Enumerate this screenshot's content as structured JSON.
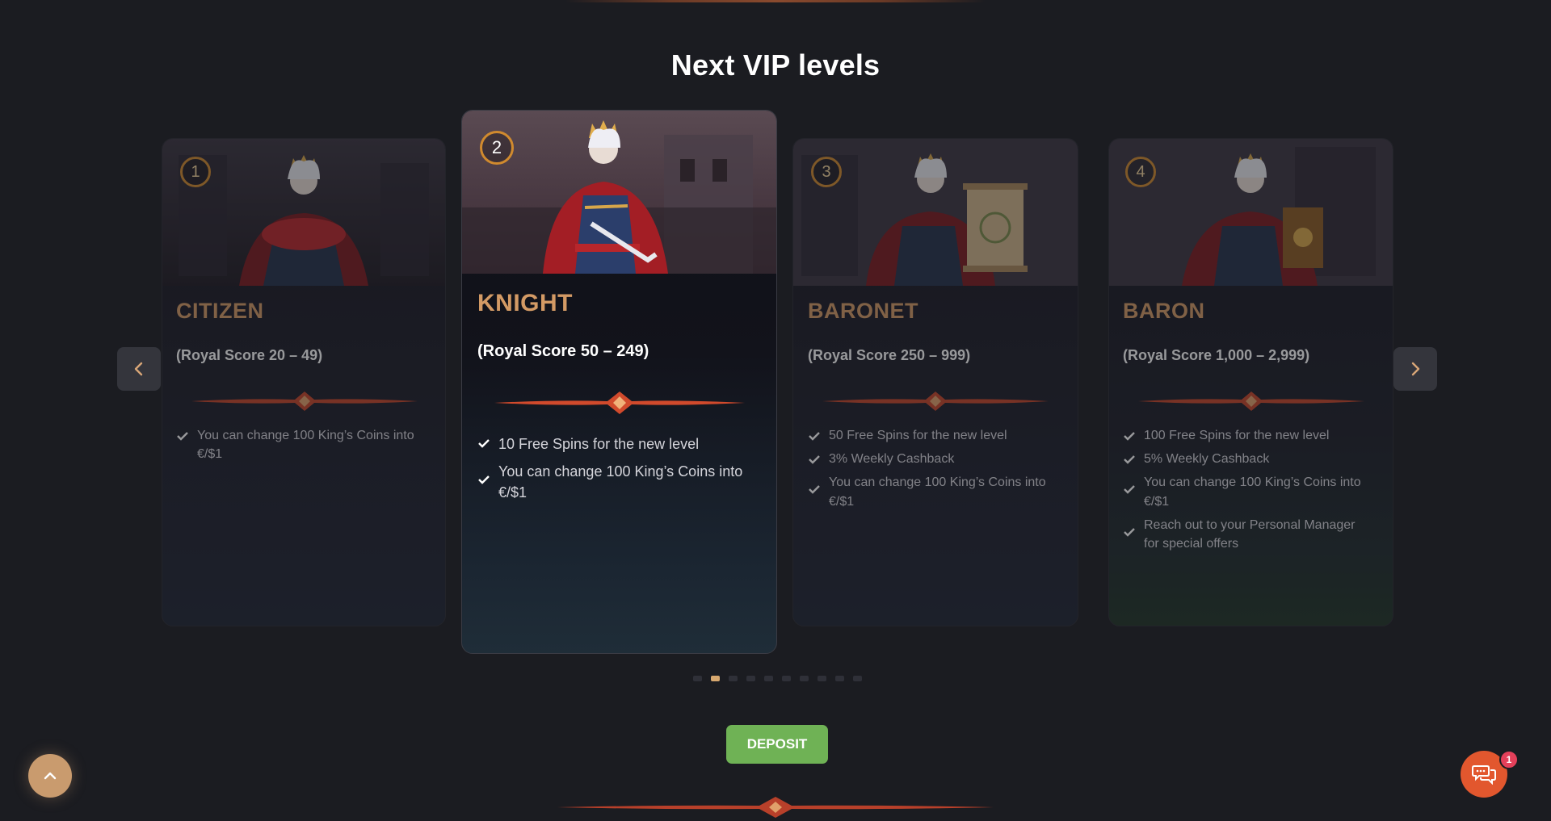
{
  "section": {
    "title": "Next VIP levels"
  },
  "carousel": {
    "cards": [
      {
        "level": "1",
        "name": "CITIZEN",
        "score": "(Royal Score 20 – 49)",
        "perks": [
          "You can change 100 King’s Coins into €/$1"
        ]
      },
      {
        "level": "2",
        "name": "KNIGHT",
        "score": "(Royal Score 50 – 249)",
        "perks": [
          "10 Free Spins for the new level",
          "You can change 100 King’s Coins into €/$1"
        ]
      },
      {
        "level": "3",
        "name": "BARONET",
        "score": "(Royal Score 250 – 999)",
        "perks": [
          "50 Free Spins for the new level",
          "3% Weekly Cashback",
          "You can change 100 King’s Coins into €/$1"
        ]
      },
      {
        "level": "4",
        "name": "BARON",
        "score": "(Royal Score 1,000 – 2,999)",
        "perks": [
          "100 Free Spins for the new level",
          "5% Weekly Cashback",
          "You can change 100 King’s Coins into €/$1",
          "Reach out to your Personal Manager for special offers"
        ]
      }
    ],
    "prev_icon": "chevron-left-icon",
    "next_icon": "chevron-right-icon",
    "pagination": {
      "total": 10,
      "active_index": 1
    }
  },
  "cta": {
    "deposit_label": "DEPOSIT"
  },
  "floating": {
    "scroll_top_icon": "chevron-up-icon",
    "chat_icon": "chat-bubbles-icon",
    "chat_badge_count": "1"
  },
  "colors": {
    "background": "#1b1c21",
    "accent_gold": "#d39a65",
    "badge_ring": "#d08a2e",
    "deposit_green": "#6fb255",
    "chat_orange": "#e2572e",
    "divider_red": "#c4452a"
  }
}
